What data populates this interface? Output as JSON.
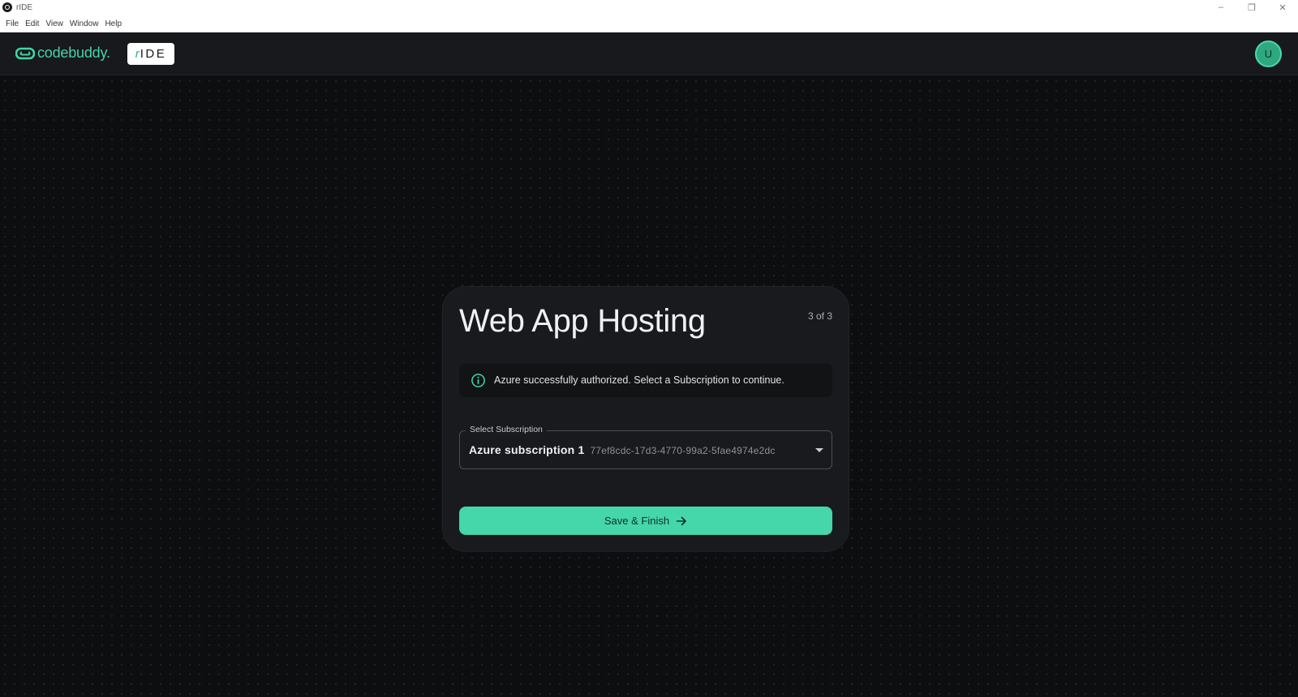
{
  "window": {
    "title": "rIDE",
    "controls": {
      "minimize": "–",
      "restore": "❐",
      "close": "✕"
    }
  },
  "menubar": {
    "items": [
      "File",
      "Edit",
      "View",
      "Window",
      "Help"
    ]
  },
  "header": {
    "logo_text": "codebuddy.",
    "badge_r": "r",
    "badge_text": "IDE",
    "avatar_initial": "U"
  },
  "card": {
    "title": "Web App Hosting",
    "step": "3 of 3",
    "alert": {
      "icon": "info-icon",
      "text": "Azure successfully authorized. Select a Subscription to continue."
    },
    "subscription": {
      "label": "Select Subscription",
      "selected_name": "Azure subscription 1",
      "selected_id": "77ef8cdc-17d3-4770-99a2-5fae4974e2dc"
    },
    "submit_label": "Save & Finish"
  },
  "colors": {
    "accent": "#45d6aa",
    "header_bg": "#17191c",
    "card_bg": "#181a1d",
    "canvas_bg": "#0d0e10"
  }
}
